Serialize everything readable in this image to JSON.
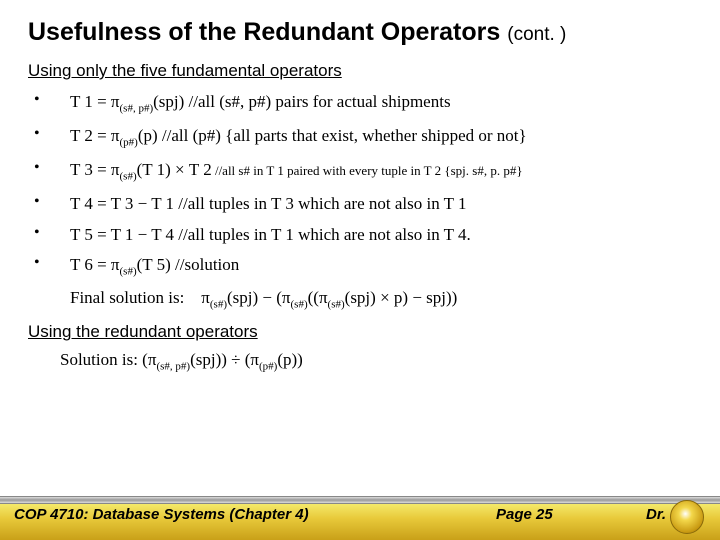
{
  "title_main": "Usefulness of the Redundant Operators",
  "title_cont": "(cont. )",
  "section1": "Using only the five fundamental operators",
  "items": {
    "t1": {
      "lhs": "T 1 = ",
      "sub": "(s#, p#)",
      "arg": "(spj)",
      "comment": "   //all (s#, p#) pairs for actual shipments"
    },
    "t2": {
      "lhs": "T 2 = ",
      "sub": "(p#)",
      "arg": "(p)",
      "comment": "  //all (p#)  {all parts that exist, whether shipped or not}"
    },
    "t3": {
      "lhs": "T 3 = ",
      "sub": "(s#)",
      "arg": "(T 1) × T 2",
      "comment": " //all s# in T 1 paired with every tuple in T 2  {spj. s#, p. p#}"
    },
    "t4": {
      "text": "T 4 = T 3 − T 1 //all tuples in T 3 which are not also in T 1"
    },
    "t5": {
      "text": "T 5 = T 1 − T 4 //all tuples in T 1 which are not also in T 4."
    },
    "t6": {
      "lhs": "T 6 = ",
      "sub": "(s#)",
      "arg": "(T 5)",
      "comment": "  //solution"
    }
  },
  "final_label": "Final solution is:",
  "final_expr_sub1": "(s#)",
  "final_expr_p1": "(spj) − (",
  "final_expr_sub2": "(s#)",
  "final_expr_p2": "((",
  "final_expr_sub3": "(s#)",
  "final_expr_p3": "(spj) × p) − spj))",
  "section2": "Using the redundant operators",
  "sol_label": "Solution is:  (",
  "sol_sub1": "(s#, p#)",
  "sol_mid": "(spj)) ÷ (",
  "sol_sub2": "(p#)",
  "sol_end": "(p))",
  "footer": {
    "course": "COP 4710: Database Systems  (Chapter 4)",
    "page": "Page 25",
    "instr": "Dr."
  }
}
